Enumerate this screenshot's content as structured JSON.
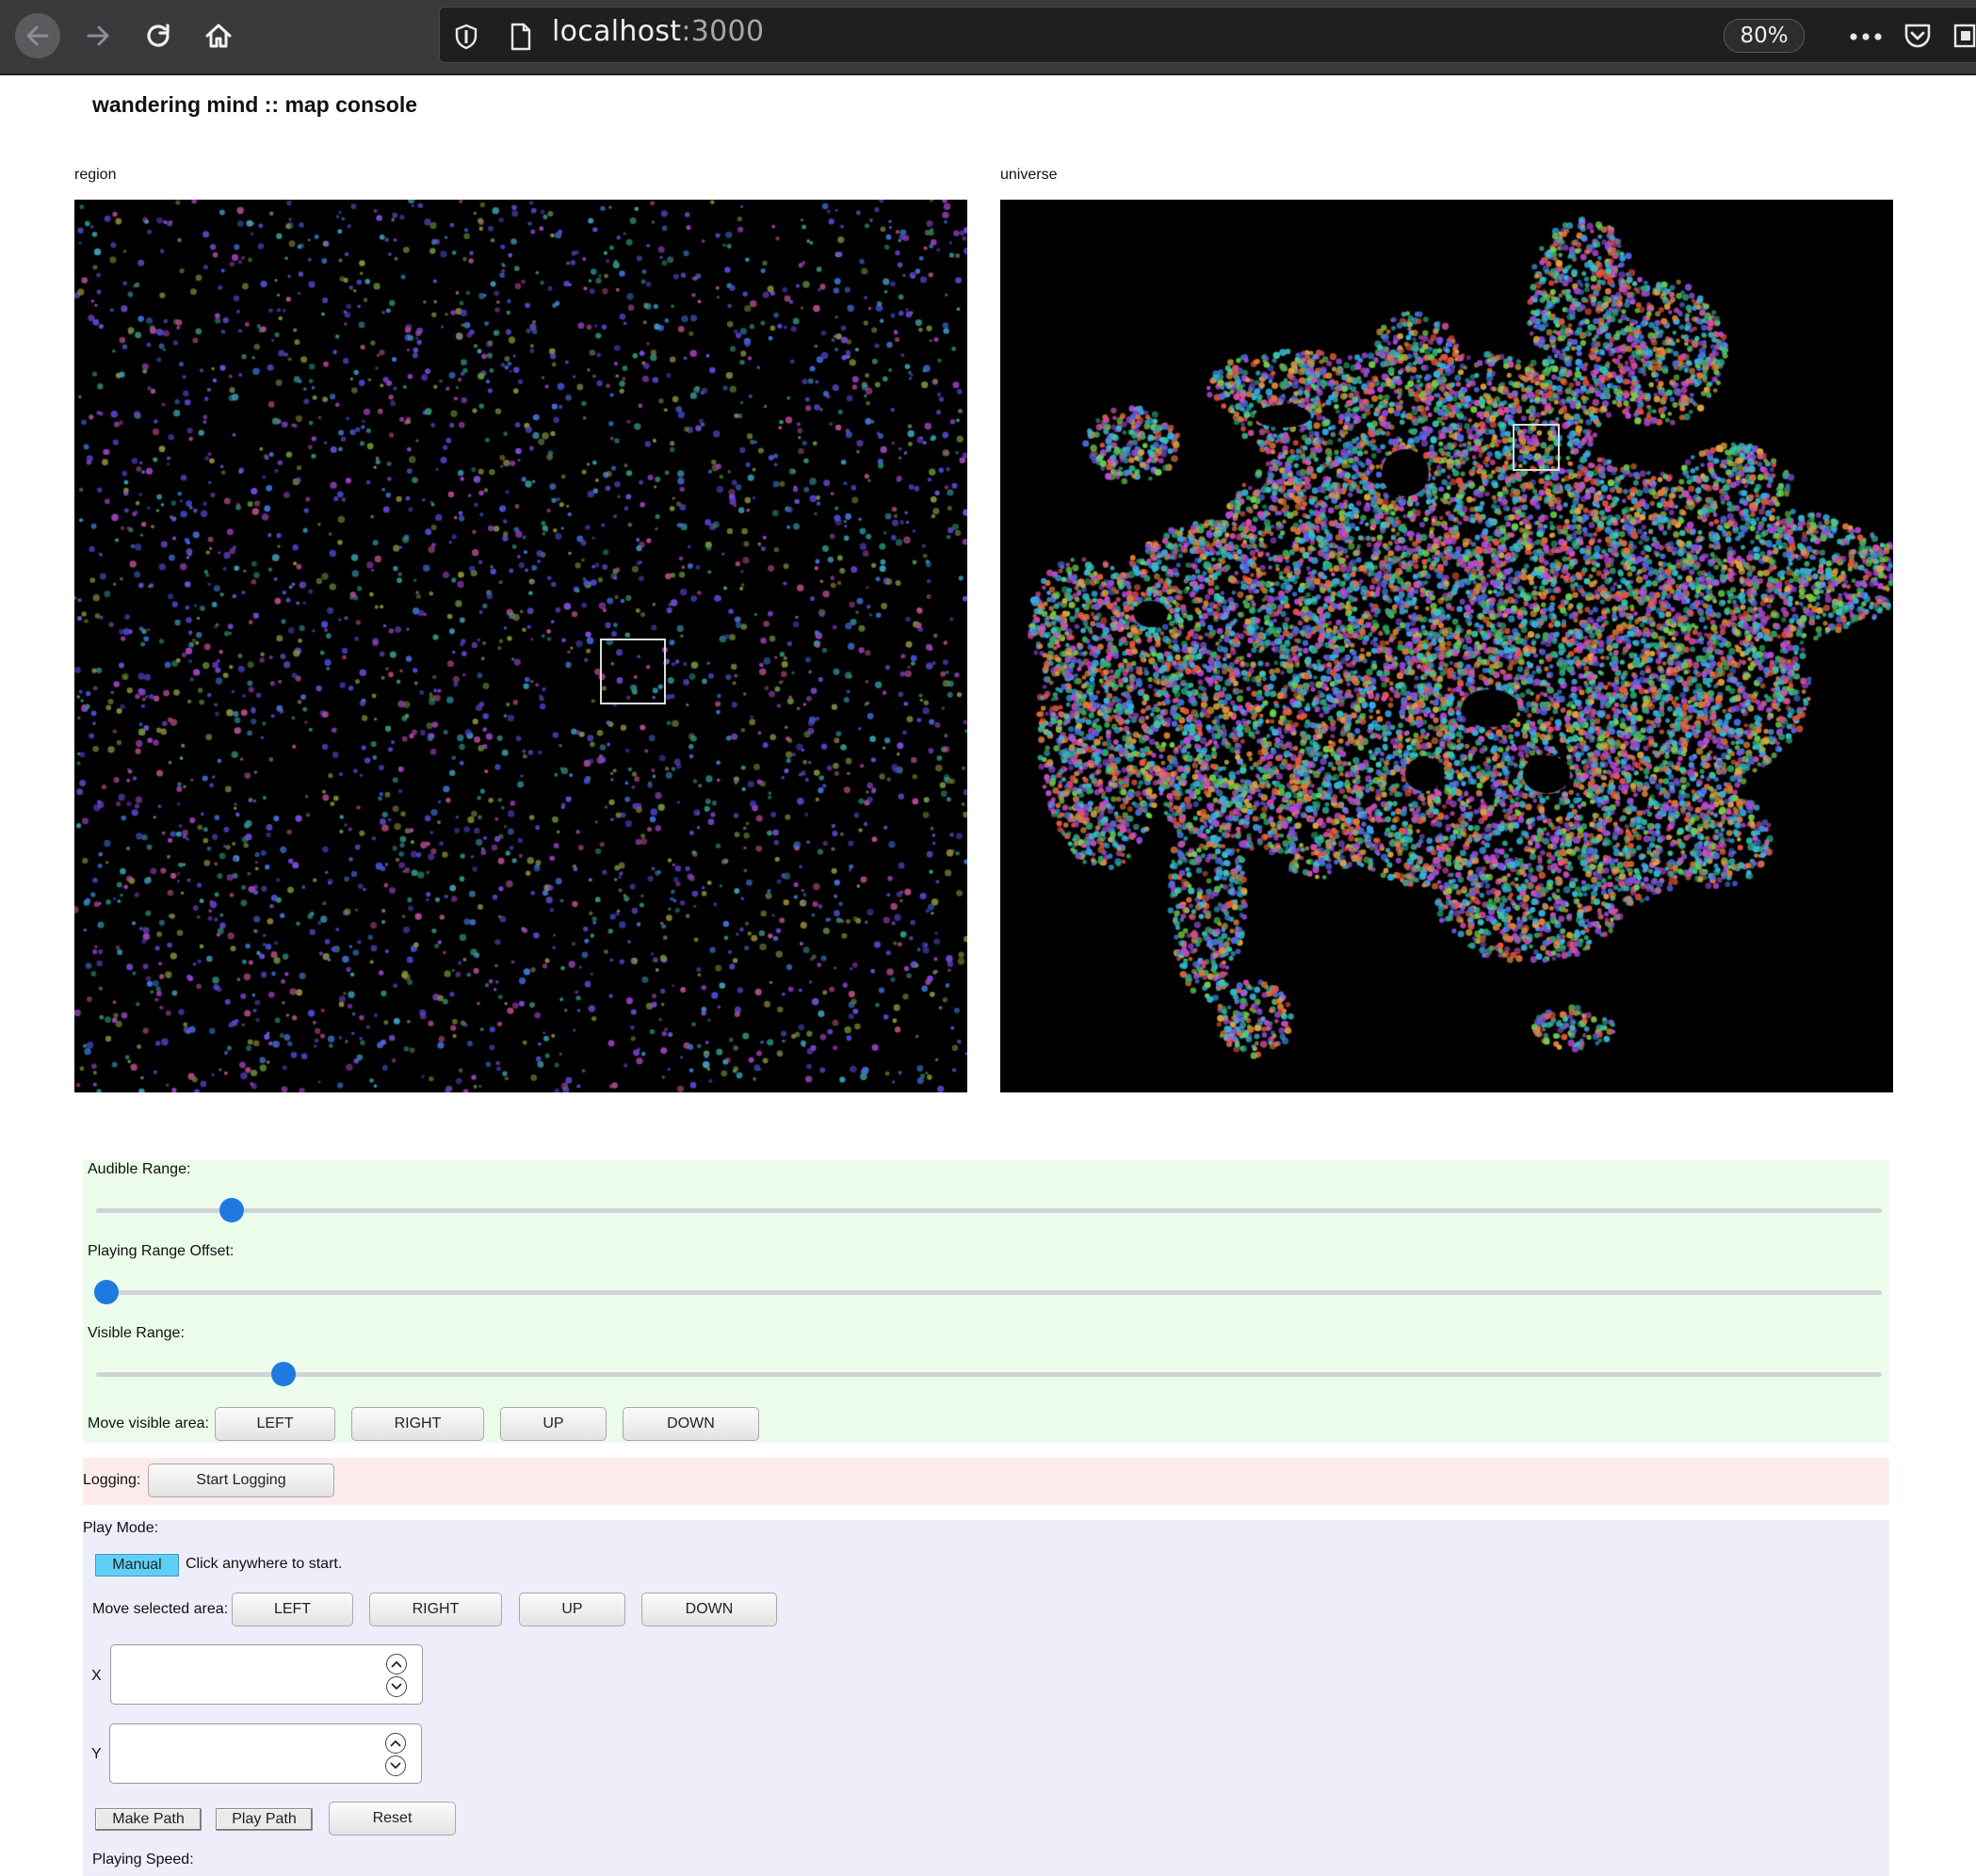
{
  "browser": {
    "url_host": "localhost",
    "url_port": ":3000",
    "zoom": "80%"
  },
  "page": {
    "title": "wandering mind :: map console"
  },
  "maps": {
    "region_label": "region",
    "universe_label": "universe"
  },
  "audio": {
    "audible_range_label": "Audible Range:",
    "audible_range_value": 0.076,
    "playing_offset_label": "Playing Range Offset:",
    "playing_offset_value": 0.006,
    "visible_range_label": "Visible Range:",
    "visible_range_value": 0.105,
    "move_visible_label": "Move visible area:",
    "move_buttons": [
      "LEFT",
      "RIGHT",
      "UP",
      "DOWN"
    ]
  },
  "logging": {
    "label": "Logging:",
    "start_button": "Start Logging"
  },
  "play": {
    "mode_label": "Play Mode:",
    "manual_button": "Manual",
    "hint": "Click anywhere to start.",
    "move_selected_label": "Move selected area:",
    "move_buttons": [
      "LEFT",
      "RIGHT",
      "UP",
      "DOWN"
    ],
    "x_label": "X",
    "x_value": "",
    "y_label": "Y",
    "y_value": "",
    "make_path_button": "Make Path",
    "play_path_button": "Play Path",
    "reset_button": "Reset",
    "speed_label": "Playing Speed:"
  },
  "colors": {
    "slider_thumb": "#1f7ae0",
    "manual_active": "#5fd0f5",
    "section_audio_bg": "#ebfceb",
    "section_logging_bg": "#fdeceb",
    "section_play_bg": "#eeeefb"
  },
  "icons": [
    "back-icon",
    "forward-icon",
    "reload-icon",
    "home-icon",
    "shield-icon",
    "page-icon",
    "more-icon",
    "pocket-icon",
    "extension-icon",
    "spin-up-icon",
    "spin-down-icon"
  ]
}
